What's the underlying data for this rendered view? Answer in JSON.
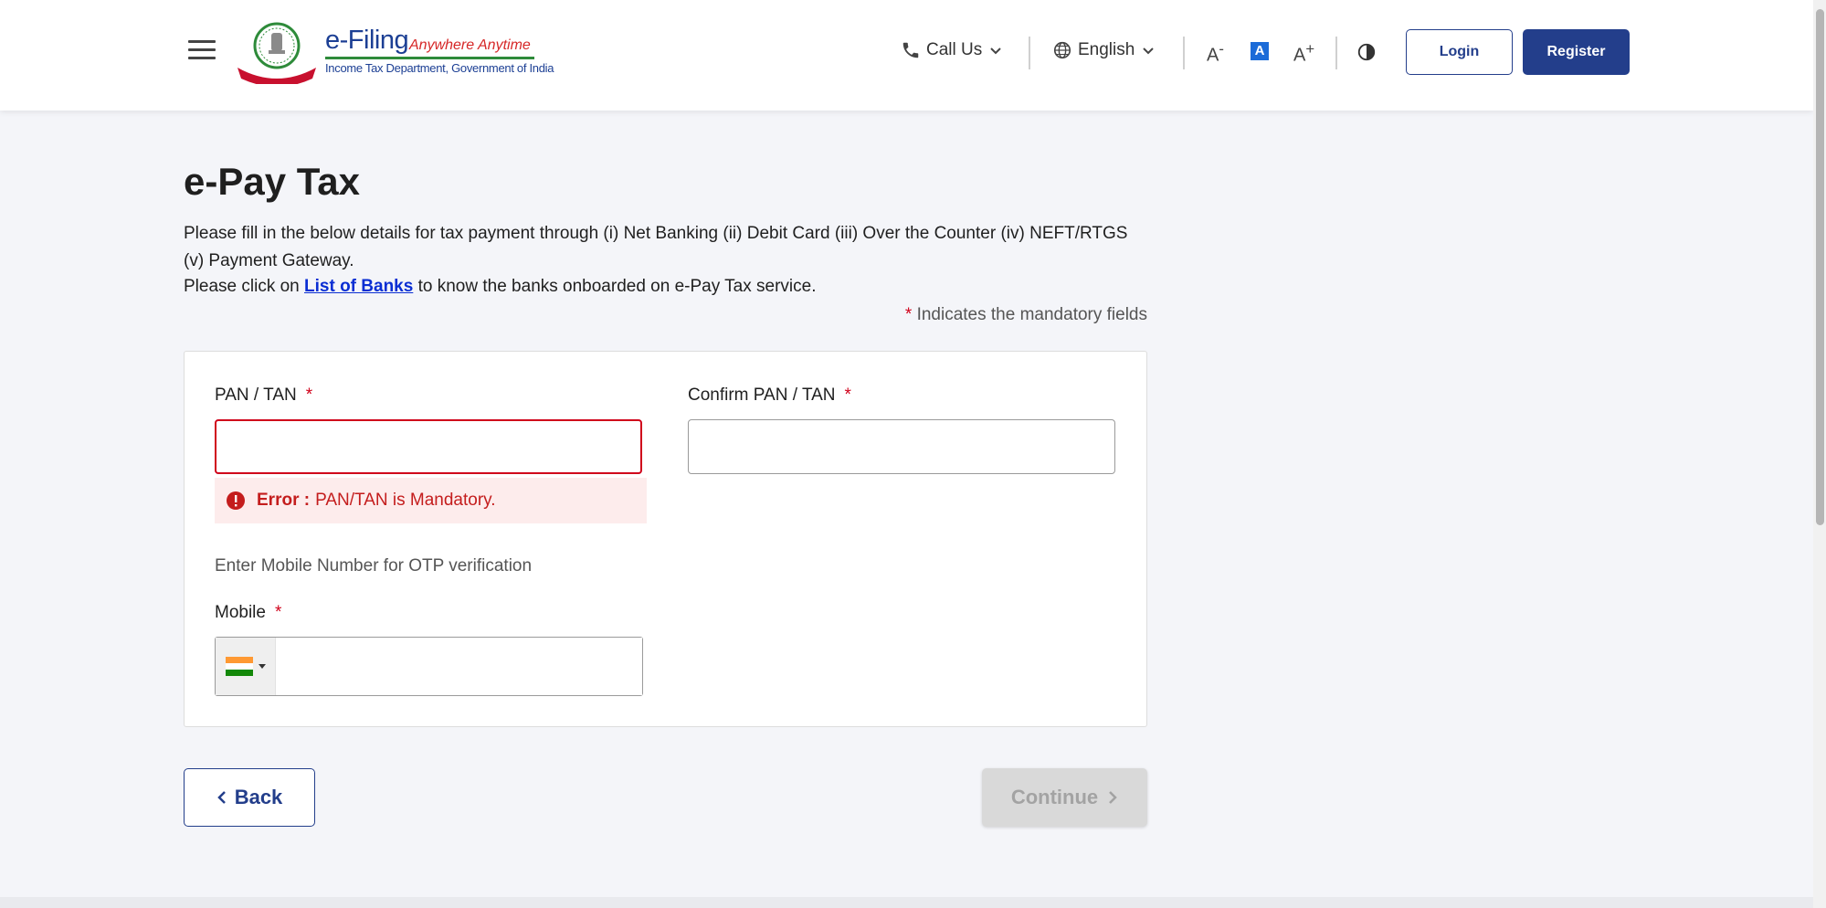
{
  "header": {
    "logo": {
      "title": "e-Filing",
      "tagline": "Anywhere Anytime",
      "department": "Income Tax Department, Government of India",
      "emblem_text": "INCOME TAX DEPARTMENT"
    },
    "call_us": "Call Us",
    "language": "English",
    "font_decrease": "A",
    "font_normal": "A",
    "font_increase": "A",
    "login": "Login",
    "register": "Register"
  },
  "main": {
    "title": "e-Pay Tax",
    "intro": "Please fill in the below details for tax payment through (i) Net Banking (ii) Debit Card (iii) Over the Counter (iv) NEFT/RTGS (v) Payment Gateway.",
    "banks_prefix": "Please click on",
    "banks_link": "List of Banks",
    "banks_suffix": "to know the banks onboarded on e-Pay Tax service.",
    "mandatory_star": "*",
    "mandatory_note": "Indicates the mandatory fields"
  },
  "form": {
    "pan_label": "PAN / TAN",
    "pan_value": "",
    "confirm_pan_label": "Confirm PAN / TAN",
    "confirm_pan_value": "",
    "required_star": "*",
    "error_prefix": "Error :",
    "error_message": "PAN/TAN is Mandatory.",
    "otp_hint": "Enter Mobile Number for OTP verification",
    "mobile_label": "Mobile",
    "mobile_value": "",
    "country_flag": "india-flag"
  },
  "actions": {
    "back": "Back",
    "continue": "Continue"
  },
  "colors": {
    "primary": "#233e8b",
    "error": "#d0021b",
    "link": "#0a2ed3",
    "disabled": "#d9d9d9"
  }
}
